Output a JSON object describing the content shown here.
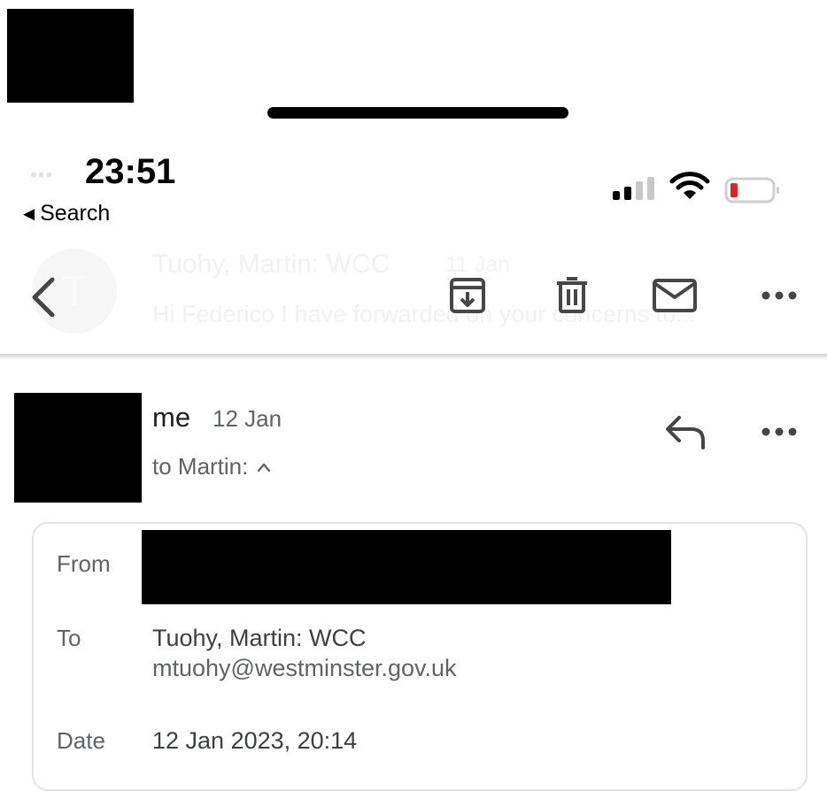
{
  "status_bar": {
    "time": "23:51",
    "back_label": "Search",
    "dots": "•••"
  },
  "ghost_message": {
    "avatar_letter": "T",
    "sender": "Tuohy, Martin: WCC",
    "date": "11 Jan",
    "snippet": "Hi Federico I have forwarded on your concerns to..."
  },
  "toolbar": {
    "icons": [
      "back-chevron-icon",
      "archive-icon",
      "trash-icon",
      "mail-icon",
      "more-icon"
    ]
  },
  "message": {
    "sender": "me",
    "date": "12 Jan",
    "to_line": "to Martin:",
    "caret": "^"
  },
  "details": {
    "from_label": "From",
    "to_label": "To",
    "to_name": "Tuohy, Martin: WCC",
    "to_email": "mtuohy@westminster.gov.uk",
    "date_label": "Date",
    "date_value": "12 Jan 2023, 20:14"
  },
  "colors": {
    "battery_low": "#e02424",
    "secondary_text": "#5f6368",
    "icon_gray": "#444746"
  }
}
